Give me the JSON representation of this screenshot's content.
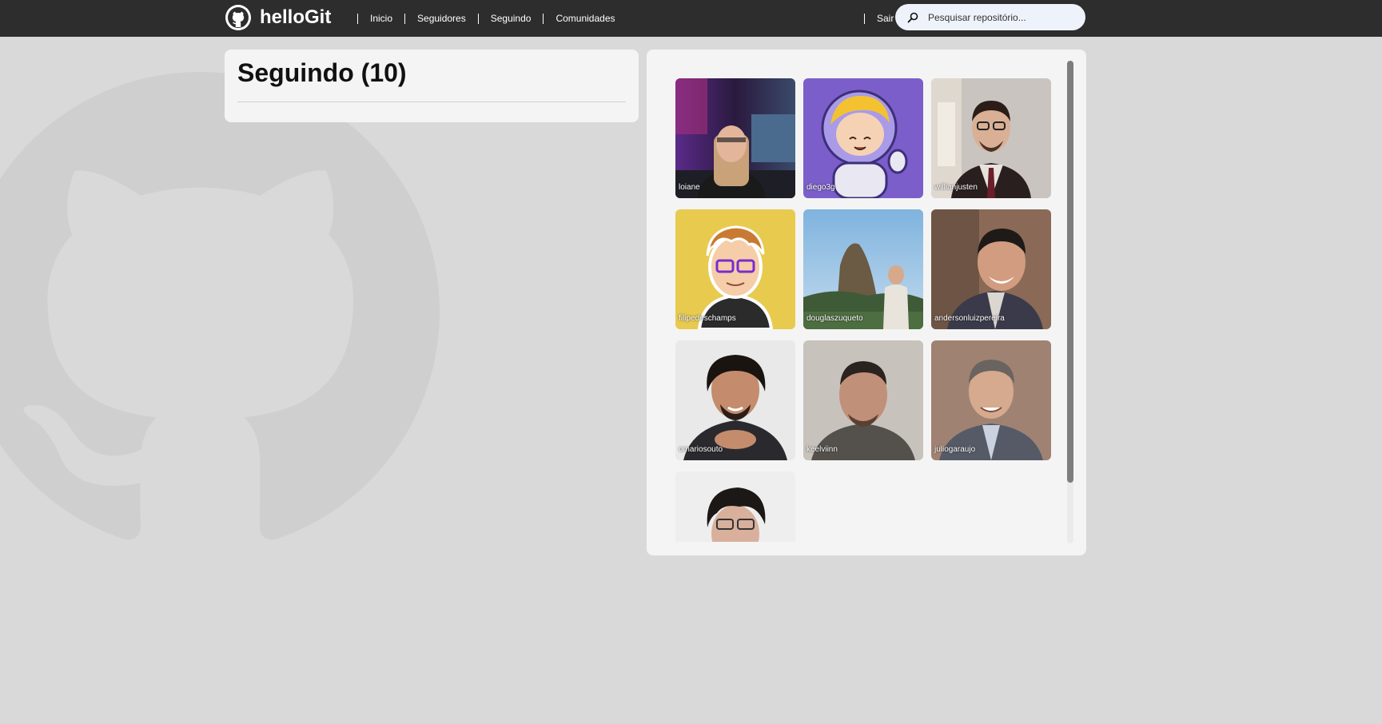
{
  "header": {
    "brand": "helloGit",
    "brand_icon": "github-icon",
    "nav": [
      {
        "label": "Inicio"
      },
      {
        "label": "Seguidores"
      },
      {
        "label": "Seguindo"
      },
      {
        "label": "Comunidades"
      }
    ],
    "logout_label": "Sair",
    "search": {
      "placeholder": "Pesquisar repositório...",
      "value": "",
      "icon": "search-icon"
    }
  },
  "page": {
    "title": "Seguindo (10)"
  },
  "following": [
    {
      "username": "loiane"
    },
    {
      "username": "diego3g"
    },
    {
      "username": "willianjusten"
    },
    {
      "username": "filipedeschamps"
    },
    {
      "username": "douglaszuqueto"
    },
    {
      "username": "andersonluizpereira"
    },
    {
      "username": "omariosouto"
    },
    {
      "username": "keelviinn"
    },
    {
      "username": "juliogaraujo"
    },
    {
      "username": ""
    }
  ],
  "colors": {
    "header_bg": "#2d2d2d",
    "page_bg": "#d9d9d9",
    "card_bg": "#f4f4f4",
    "search_bg": "#eef3fb",
    "scrollbar_thumb": "#7d7d7d"
  }
}
